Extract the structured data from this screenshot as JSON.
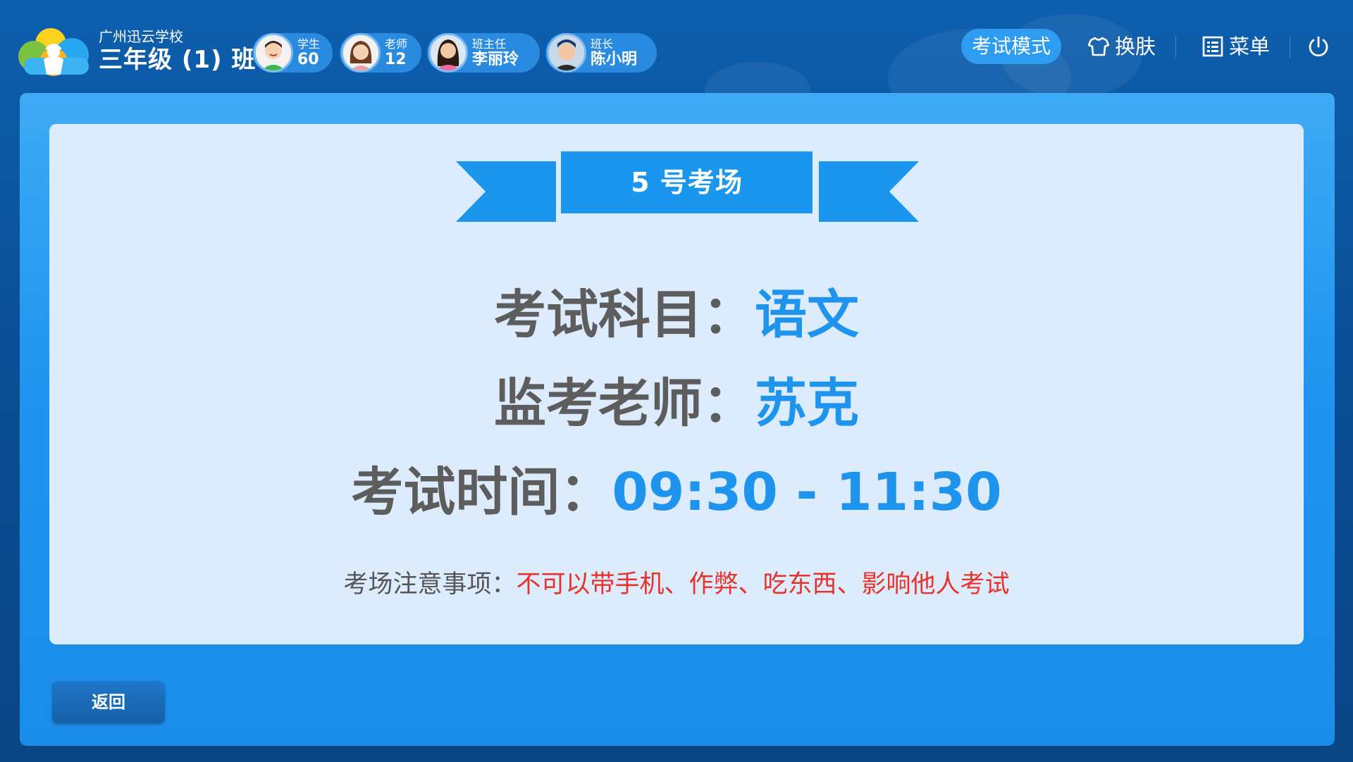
{
  "header": {
    "school_name": "广州迅云学校",
    "class_name": "三年级 (1) 班",
    "stats": [
      {
        "label": "学生",
        "value": "60"
      },
      {
        "label": "老师",
        "value": "12"
      },
      {
        "label": "班主任",
        "value": "李丽玲"
      },
      {
        "label": "班长",
        "value": "陈小明"
      }
    ],
    "mode_label": "考试模式",
    "skin_label": "换肤",
    "menu_label": "菜单"
  },
  "exam": {
    "room_title": "5 号考场",
    "subject_label": "考试科目：",
    "subject_value": "语文",
    "proctor_label": "监考老师：",
    "proctor_value": "苏克",
    "time_label": "考试时间：",
    "time_value": "09:30 - 11:30",
    "notice_label": "考场注意事项：",
    "notice_value": "不可以带手机、作弊、吃东西、影响他人考试"
  },
  "footer": {
    "back_label": "返回"
  },
  "colors": {
    "accent": "#1f94ee",
    "warning": "#e8322a",
    "card_bg": "#dcecfc"
  }
}
